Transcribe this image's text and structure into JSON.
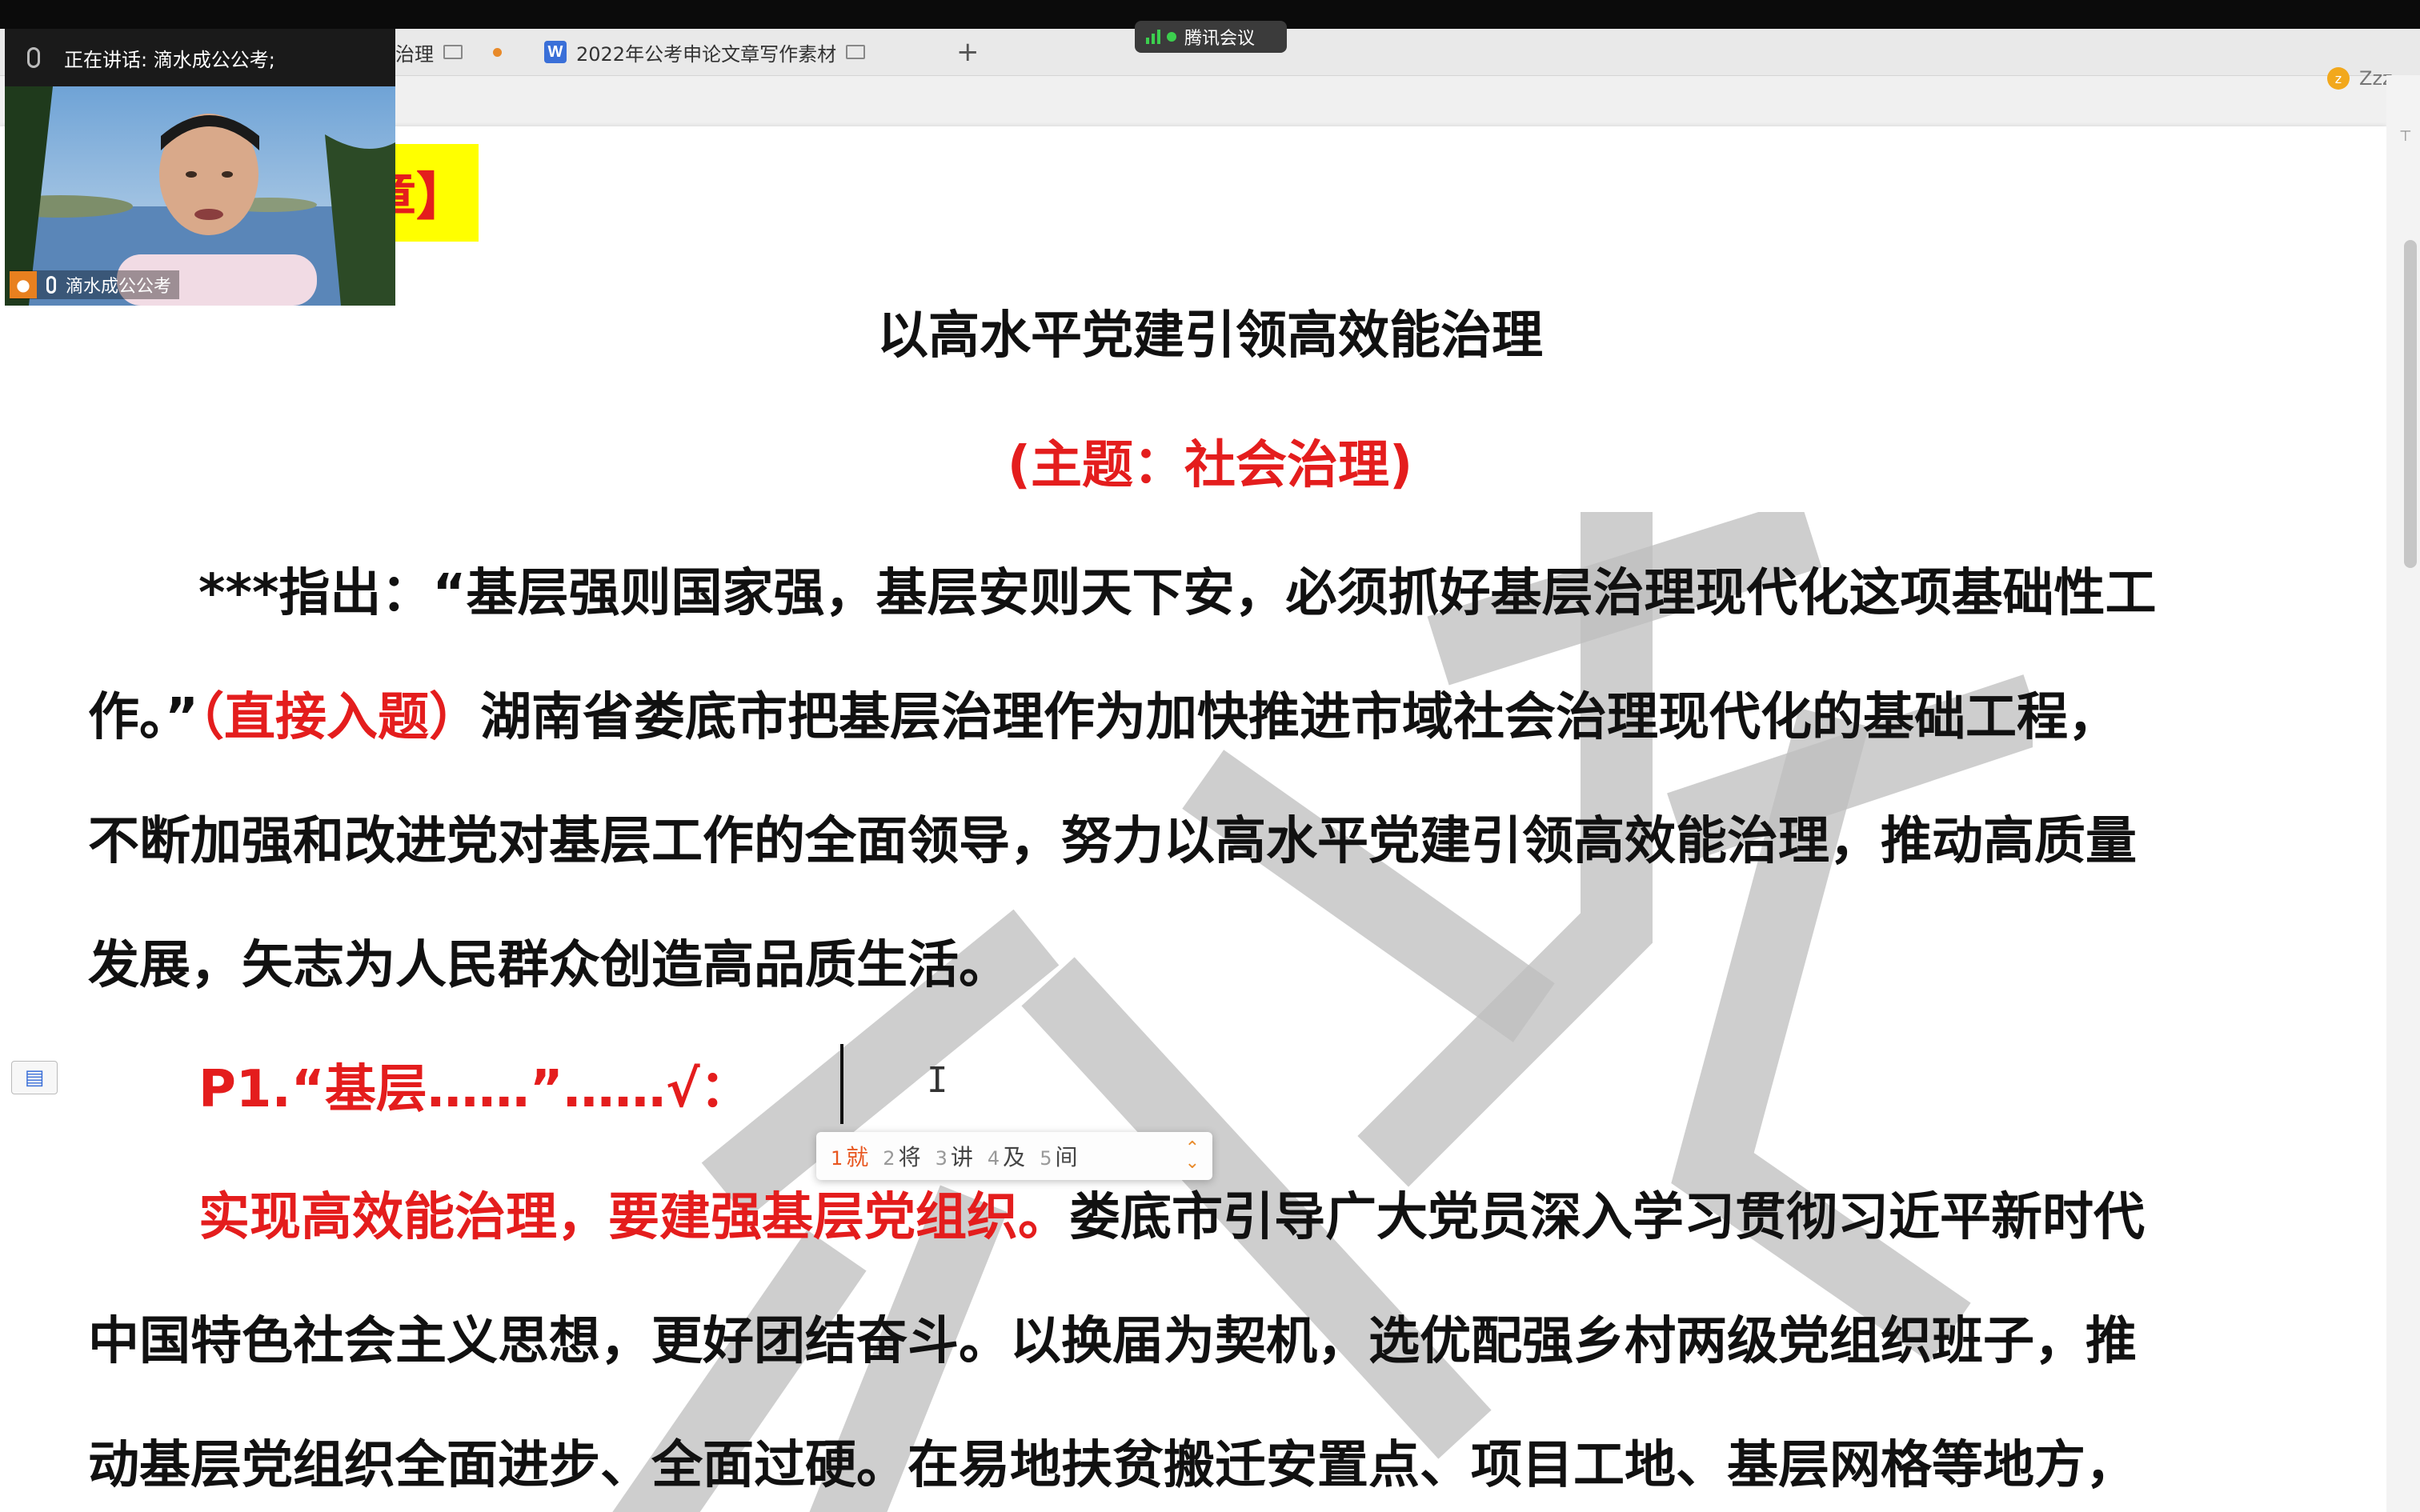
{
  "tabs": [
    {
      "label": "会治理"
    },
    {
      "label": "2022年公考申论文章写作素材",
      "icon": "W"
    }
  ],
  "new_tab_symbol": "+",
  "meeting": {
    "title": "腾讯会议"
  },
  "status_right": {
    "label": "Zzz"
  },
  "camera": {
    "speaking_label": "正在讲话: 滴水成公公考;",
    "participant_name": "滴水成公公考"
  },
  "document": {
    "tag_fragment": "章】",
    "title": "以高水平党建引领高效能治理",
    "subtitle": "(主题：社会治理)",
    "line1": "***指出：“基层强则国家强，基层安则天下安，必须抓好基层治理现代化这项基础性工",
    "line2_a": "作。”",
    "line2_red": "（直接入题）",
    "line2_b": "湖南省娄底市把基层治理作为加快推进市域社会治理现代化的基础工程，",
    "line3": "不断加强和改进党对基层工作的全面领导，努力以高水平党建引领高效能治理，推动高质量",
    "line4": "发展，矢志为人民群众创造高品质生活。",
    "p1_line": "P1.“基层……”……√：",
    "line5_red": "实现高效能治理，要建强基层党组织。",
    "line5_b": "娄底市引导广大党员深入学习贯彻习近平新时代",
    "line6": "中国特色社会主义思想，更好团结奋斗。以换届为契机，选优配强乡村两级党组织班子，推",
    "line7": "动基层党组织全面进步、全面过硬。在易地扶贫搬迁安置点、项目工地、基层网格等地方，"
  },
  "ime": {
    "candidates": [
      {
        "num": "1",
        "text": "就"
      },
      {
        "num": "2",
        "text": "将"
      },
      {
        "num": "3",
        "text": "讲"
      },
      {
        "num": "4",
        "text": "及"
      },
      {
        "num": "5",
        "text": "间"
      }
    ]
  },
  "colors": {
    "accent_red": "#e41d1d",
    "highlight_yellow": "#ffff00",
    "meeting_green": "#3ccf4e"
  }
}
